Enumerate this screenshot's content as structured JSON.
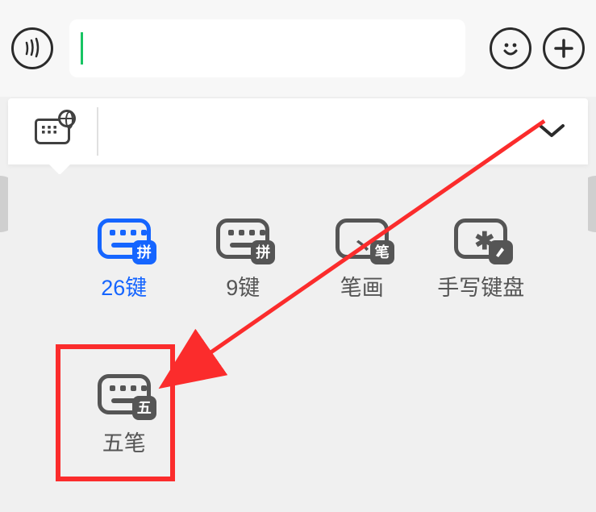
{
  "input_bar": {
    "voice_icon": "voice",
    "emoji_icon": "emoji",
    "plus_icon": "plus",
    "input_value": ""
  },
  "ime_strip": {
    "globe_icon": "globe-keyboard",
    "collapse_icon": "chevron-down"
  },
  "layout_options": [
    {
      "id": "26key",
      "label": "26键",
      "badge": "拼",
      "selected": true,
      "icon": "keyboard-dots"
    },
    {
      "id": "9key",
      "label": "9键",
      "badge": "拼",
      "selected": false,
      "icon": "keyboard-dots"
    },
    {
      "id": "stroke",
      "label": "笔画",
      "badge": "笔",
      "selected": false,
      "icon": "keyboard-stroke"
    },
    {
      "id": "handwrite",
      "label": "手写键盘",
      "badge": "",
      "selected": false,
      "icon": "keyboard-hand"
    },
    {
      "id": "wubi",
      "label": "五笔",
      "badge": "五",
      "selected": false,
      "icon": "keyboard-dots"
    }
  ],
  "annotation": {
    "highlight_target": "wubi",
    "highlight_color": "#fb2c2c"
  }
}
